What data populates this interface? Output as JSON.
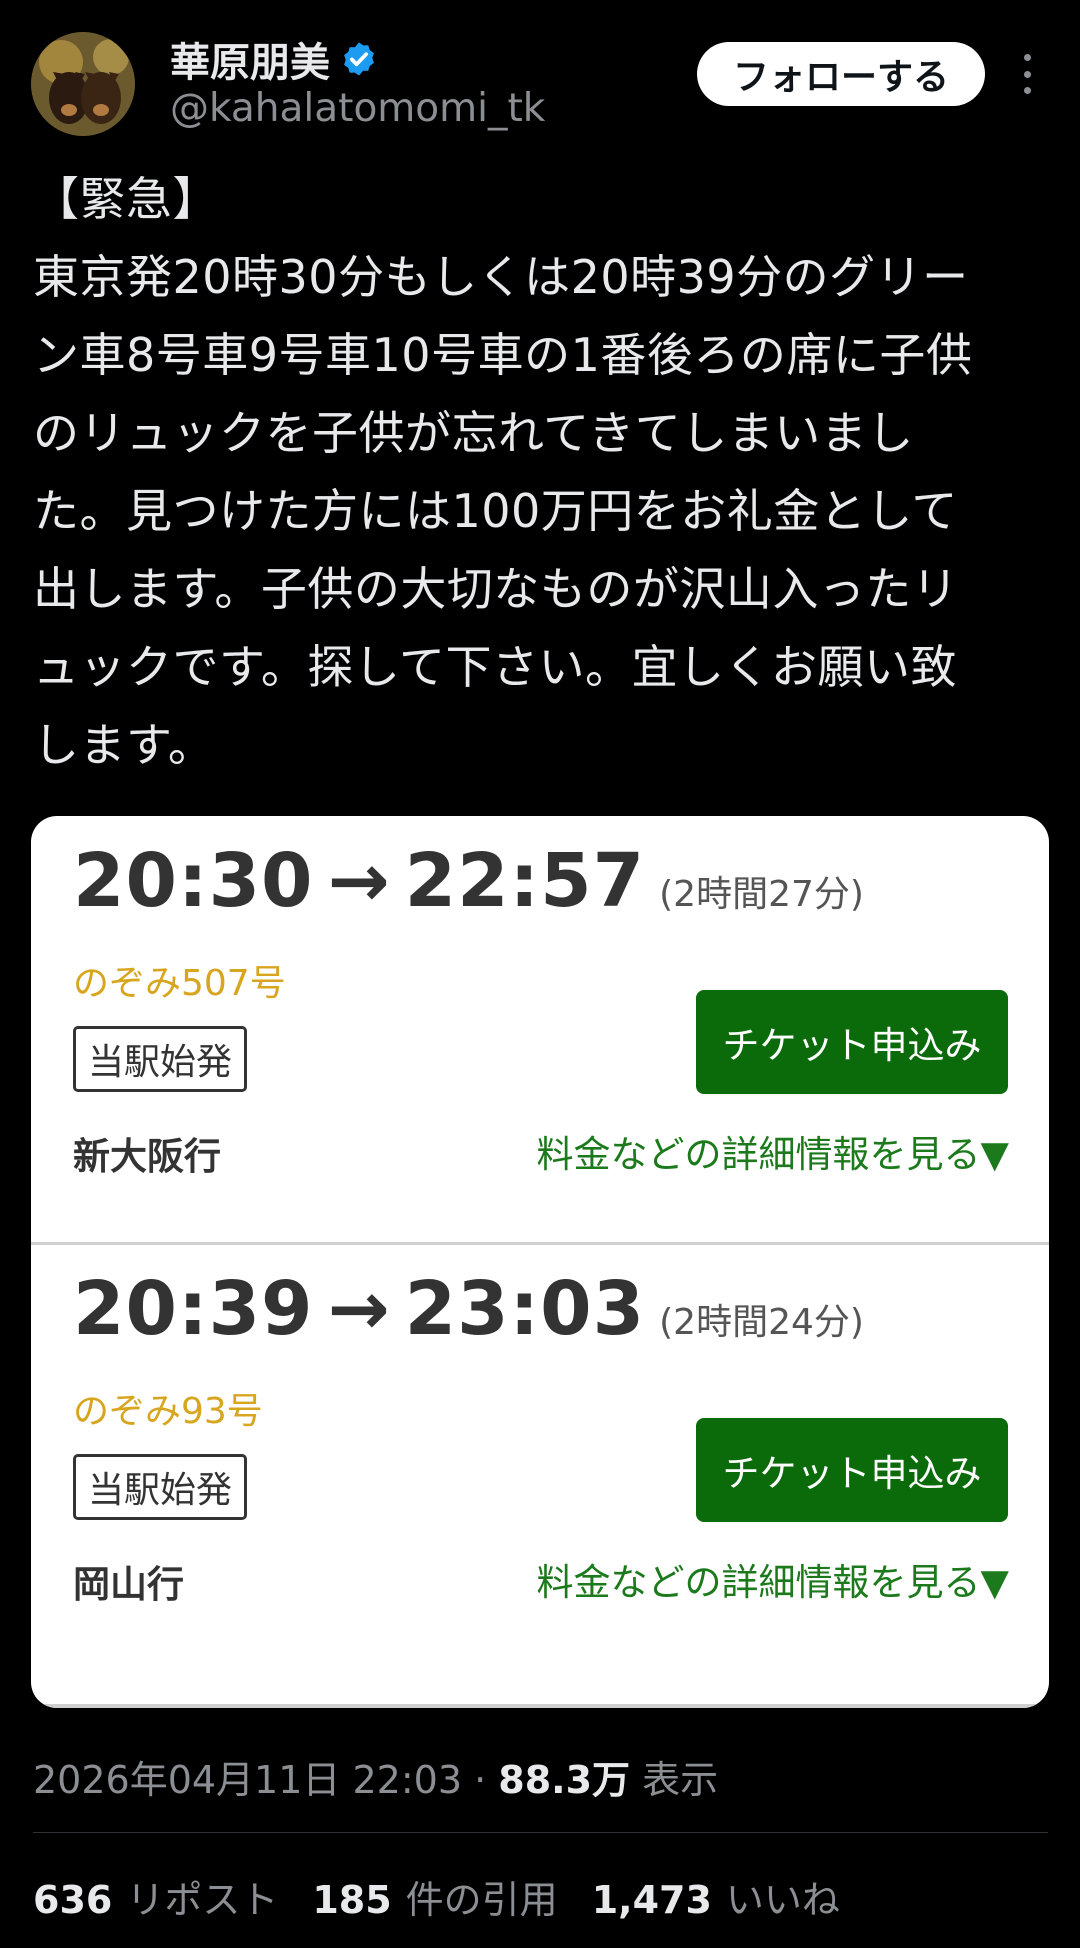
{
  "user": {
    "name": "華原朋美",
    "handle": "@kahalatomomi_tk",
    "follow_label": "フォローする"
  },
  "tweet": {
    "lines": [
      "【緊急】",
      "東京発20時30分もしくは20時39分のグリー",
      "ン車8号車9号車10号車の1番後ろの席に子供",
      "のリュックを子供が忘れてきてしまいまし",
      "た。見つけた方には100万円をお礼金として",
      "出します。子供の大切なものが沢山入ったリ",
      "ュックです。探して下さい。宜しくお願い致",
      "します。"
    ]
  },
  "trains": [
    {
      "depart": "20:30",
      "arrow": "→",
      "arrive": "22:57",
      "duration": "(2時間27分)",
      "name": "のぞみ507号",
      "origin_badge": "当駅始発",
      "destination": "新大阪行",
      "ticket_label": "チケット申込み",
      "details_label": "料金などの詳細情報を見る▼"
    },
    {
      "depart": "20:39",
      "arrow": "→",
      "arrive": "23:03",
      "duration": "(2時間24分)",
      "name": "のぞみ93号",
      "origin_badge": "当駅始発",
      "destination": "岡山行",
      "ticket_label": "チケット申込み",
      "details_label": "料金などの詳細情報を見る▼"
    }
  ],
  "meta": {
    "timestamp": "2026年04月11日 22:03",
    "separator": "·",
    "views_count": "88.3万",
    "views_label": "表示"
  },
  "stats": {
    "reposts_count": "636",
    "reposts_label": "リポスト",
    "quotes_count": "185",
    "quotes_label": "件の引用",
    "likes_count": "1,473",
    "likes_label": "いいね"
  },
  "colors": {
    "background": "#000000",
    "verified": "#1d9bf0",
    "ticket_button": "#0b6b0b",
    "train_name": "#d8a51e",
    "details_link": "#1c7a1c"
  }
}
